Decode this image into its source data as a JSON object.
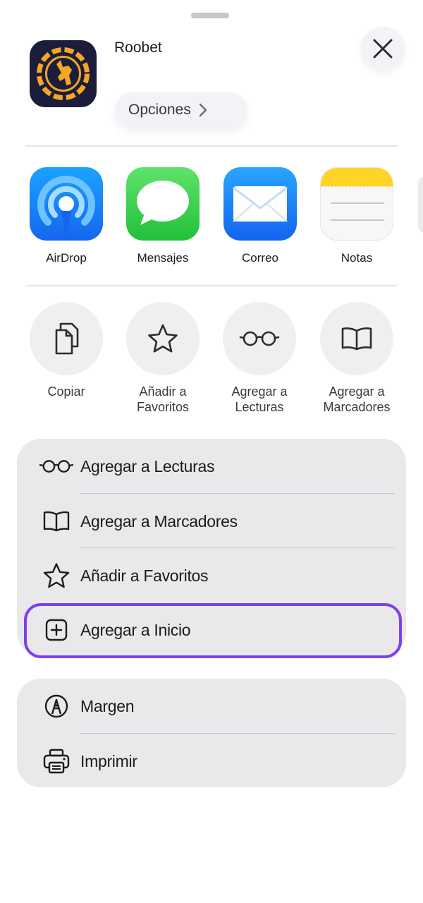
{
  "header": {
    "app_name": "Roobet",
    "options_label": "Opciones",
    "app_icon": "roobet-kangaroo-logo",
    "close_icon": "close-icon",
    "options_icon": "chevron-right-icon"
  },
  "share_apps": [
    {
      "label": "AirDrop",
      "icon": "airdrop-icon",
      "color": "#1a7cf5"
    },
    {
      "label": "Mensajes",
      "icon": "messages-icon",
      "color": "#34c759"
    },
    {
      "label": "Correo",
      "icon": "mail-icon",
      "color": "#1f8bf6"
    },
    {
      "label": "Notas",
      "icon": "notes-icon",
      "color": "#ffd426"
    }
  ],
  "quick_actions": [
    {
      "label": "Copiar",
      "icon": "copy-icon"
    },
    {
      "label": "Añadir a Favoritos",
      "icon": "star-icon"
    },
    {
      "label": "Agregar a Lecturas",
      "icon": "glasses-icon"
    },
    {
      "label": "Agregar a Marcadores",
      "icon": "book-icon"
    }
  ],
  "menu_group_1": [
    {
      "label": "Agregar a Lecturas",
      "icon": "glasses-icon"
    },
    {
      "label": "Agregar a Marcadores",
      "icon": "book-icon"
    },
    {
      "label": "Añadir a Favoritos",
      "icon": "star-icon"
    },
    {
      "label": "Agregar a Inicio",
      "icon": "plus-square-icon",
      "highlighted": true
    }
  ],
  "menu_group_2": [
    {
      "label": "Margen",
      "icon": "markup-icon"
    },
    {
      "label": "Imprimir",
      "icon": "printer-icon"
    }
  ],
  "colors": {
    "highlight": "#7e3ff2",
    "sheet_background": "#ffffff",
    "group_background": "#e9e9eb"
  }
}
